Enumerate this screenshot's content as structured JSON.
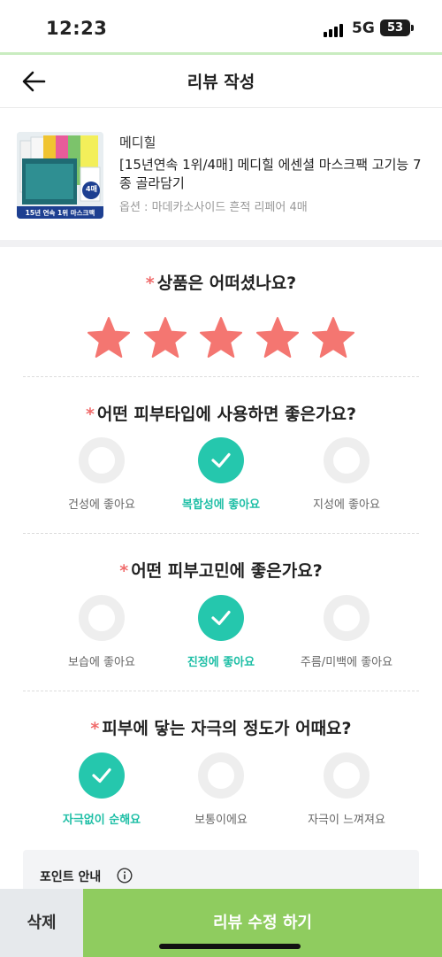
{
  "status": {
    "time": "12:23",
    "network": "5G",
    "battery": "53"
  },
  "header": {
    "title": "리뷰 작성",
    "back_icon": "arrow-left-icon"
  },
  "product": {
    "brand": "메디힐",
    "name": "[15년연속 1위/4매] 메디힐 에센셜 마스크팩 고기능 7종 골라담기",
    "option": "옵션 : 마데카소사이드 흔적 리페어 4매",
    "thumb_badge": "4매",
    "thumb_banner": "15년 연속 1위 마스크팩"
  },
  "rating": {
    "question": "상품은 어떠셨나요?",
    "value": 5,
    "max": 5,
    "star_color": "#f47671"
  },
  "skin_type": {
    "question": "어떤 피부타입에 사용하면 좋은가요?",
    "options": [
      "건성에 좋아요",
      "복합성에 좋아요",
      "지성에 좋아요"
    ],
    "selected": "복합성에 좋아요"
  },
  "skin_concern": {
    "question": "어떤 피부고민에 좋은가요?",
    "options": [
      "보습에 좋아요",
      "진정에 좋아요",
      "주름/미백에 좋아요"
    ],
    "selected": "진정에 좋아요"
  },
  "irritation": {
    "question": "피부에 닿는 자극의 정도가 어때요?",
    "options": [
      "자극없이 순해요",
      "보통이에요",
      "자극이 느껴져요"
    ],
    "selected": "자극없이 순해요"
  },
  "point_info": {
    "title": "포인트 안내",
    "icon": "info-icon"
  },
  "footer": {
    "delete_label": "삭제",
    "submit_label": "리뷰 수정 하기"
  },
  "colors": {
    "accent": "#25c7ad",
    "submit": "#8fcc5f",
    "required": "#f06c6c"
  }
}
